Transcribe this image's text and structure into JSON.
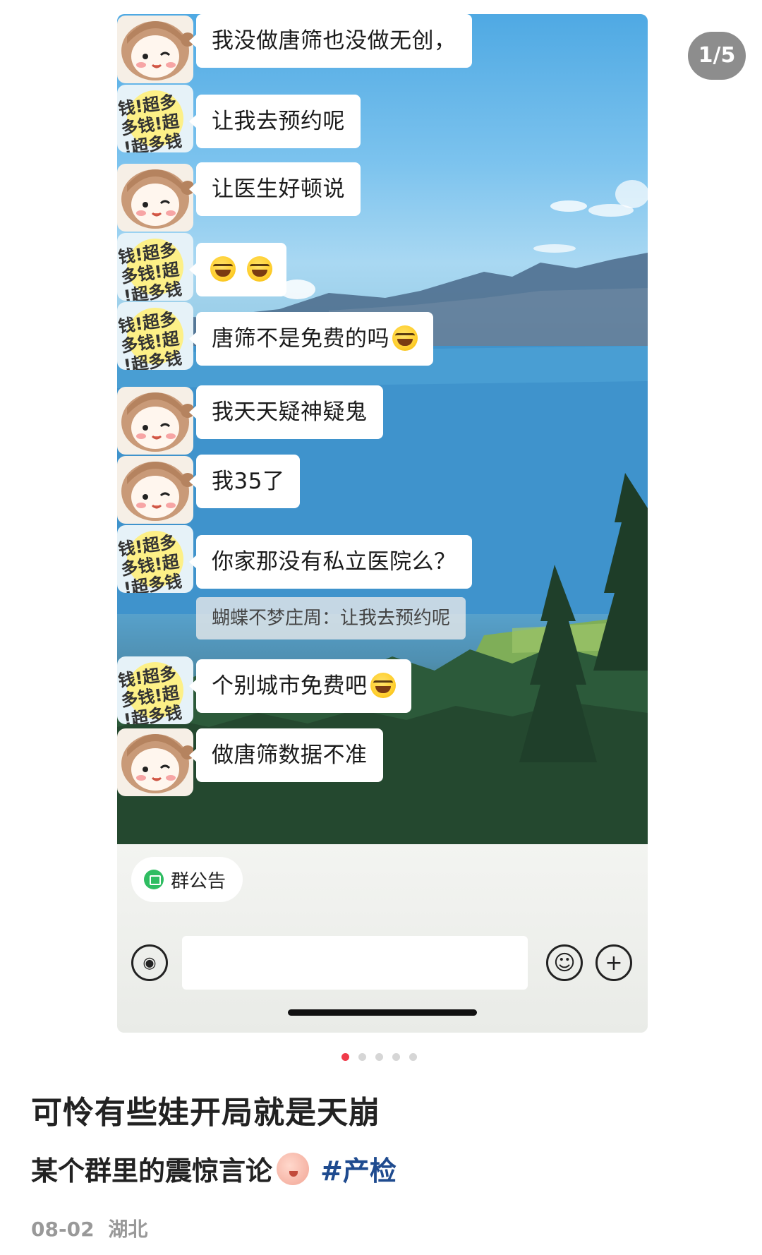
{
  "pager": {
    "label": "1/5",
    "dot_count": 5,
    "active_index": 0
  },
  "chat": {
    "messages": [
      {
        "avatar": "girl",
        "text": "我没做唐筛也没做无创，"
      },
      {
        "avatar": "money",
        "text": "让我去预约呢"
      },
      {
        "avatar": "girl",
        "text": "让医生好顿说"
      },
      {
        "avatar": "money",
        "text": "",
        "emoji": [
          "laugh-cry-emoji",
          "laugh-cry-emoji"
        ]
      },
      {
        "avatar": "money",
        "text": "唐筛不是免费的吗"
      },
      {
        "avatar": "girl",
        "text": "我天天疑神疑鬼"
      },
      {
        "avatar": "girl",
        "text": "我35了"
      },
      {
        "avatar": "money",
        "text": "你家那没有私立医院么？",
        "quote": "蝴蝶不梦庄周：让我去预约呢"
      },
      {
        "avatar": "money",
        "text": "个别城市免费吧"
      },
      {
        "avatar": "girl",
        "text": "做唐筛数据不准"
      }
    ],
    "avatar_text": "钱!超多钱!超多"
  },
  "chatbar": {
    "notice_label": "群公告",
    "input_value": ""
  },
  "post": {
    "title": "可怜有些娃开局就是天崩",
    "body": "某个群里的震惊言论",
    "tag": "#产检",
    "date": "08-02",
    "location": "湖北"
  },
  "colors": {
    "active_dot": "#f03b4a",
    "tag": "#1f4b8f",
    "notice_icon": "#2fbd62"
  }
}
